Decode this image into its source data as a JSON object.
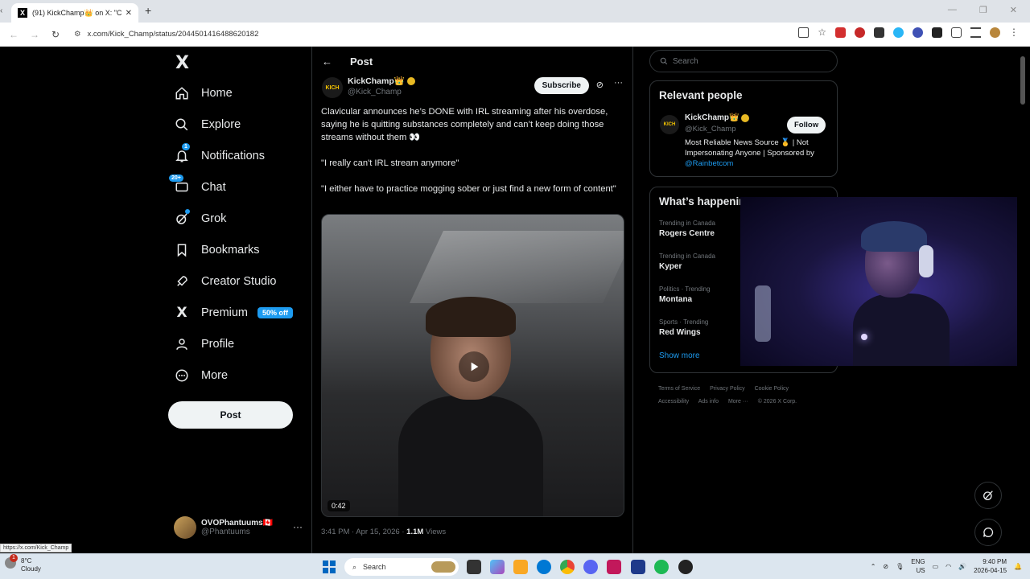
{
  "browser": {
    "tab_title": "(91) KickChamp👑 on X: \"Clavic",
    "new_tab": "+",
    "url": "x.com/Kick_Champ/status/2044501416488620182",
    "status_url": "https://x.com/Kick_Champ"
  },
  "nav": {
    "items": [
      {
        "label": "Home",
        "icon": "home-icon"
      },
      {
        "label": "Explore",
        "icon": "search-icon"
      },
      {
        "label": "Notifications",
        "icon": "bell-icon",
        "badge": "1"
      },
      {
        "label": "Chat",
        "icon": "chat-icon",
        "badge": "20+"
      },
      {
        "label": "Grok",
        "icon": "grok-icon"
      },
      {
        "label": "Bookmarks",
        "icon": "bookmark-icon"
      },
      {
        "label": "Creator Studio",
        "icon": "rocket-icon"
      },
      {
        "label": "Premium",
        "icon": "x-logo-icon",
        "pill": "50% off"
      },
      {
        "label": "Profile",
        "icon": "person-icon"
      },
      {
        "label": "More",
        "icon": "more-circle-icon"
      }
    ],
    "post_button": "Post",
    "me_name": "OVOPhantuums🇨🇦",
    "me_handle": "@Phantuums"
  },
  "post": {
    "header": "Post",
    "author_name": "KickChamp👑",
    "author_handle": "@Kick_Champ",
    "avatar_text": "KICH",
    "subscribe": "Subscribe",
    "paragraphs": [
      "Clavicular announces he’s DONE with IRL streaming after his overdose, saying he is quitting substances completely and can’t keep doing those streams without them 👀",
      "\"I really can't IRL stream anymore\"",
      "\"I either have to practice mogging sober or just find a new form of content\""
    ],
    "video_duration": "0:42",
    "time": "3:41 PM · Apr 15, 2026 · ",
    "views_count": "1.1M",
    "views_label": " Views"
  },
  "right": {
    "search_placeholder": "Search",
    "relevant_title": "Relevant people",
    "rp_name": "KickChamp👑",
    "rp_handle": "@Kick_Champ",
    "rp_bio": "Most Reliable News Source 🥇 | Not Impersonating Anyone | Sponsored by ",
    "rp_link": "@Rainbetcom",
    "follow": "Follow",
    "happening_title": "What’s happening",
    "trends": [
      {
        "cat": "Trending in Canada",
        "title": "Rogers Centre"
      },
      {
        "cat": "Trending in Canada",
        "title": "Kyper"
      },
      {
        "cat": "Politics · Trending",
        "title": "Montana"
      },
      {
        "cat": "Sports · Trending",
        "title": "Red Wings"
      }
    ],
    "show_more": "Show more",
    "footer_links": [
      "Terms of Service",
      "Privacy Policy",
      "Cookie Policy",
      "Accessibility",
      "Ads info",
      "More ···",
      "© 2026 X Corp."
    ]
  },
  "taskbar": {
    "temp": "8°C",
    "weather": "Cloudy",
    "weather_badge": "1",
    "search": "Search",
    "lang1": "ENG",
    "lang2": "US",
    "time": "9:40 PM",
    "date": "2026-04-15"
  }
}
